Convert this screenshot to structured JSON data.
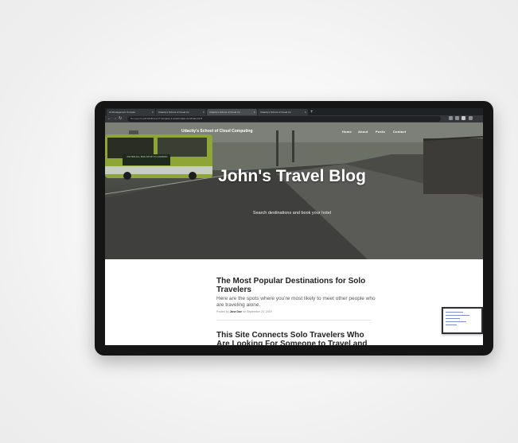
{
  "browser": {
    "tabs": [
      {
        "title": "AI Management Console",
        "active": false
      },
      {
        "title": "Udacity's School of Cloud Co",
        "active": false
      },
      {
        "title": "Udacity's School of Cloud Co",
        "active": true
      },
      {
        "title": "Udacity's School of Cloud Co",
        "active": false
      }
    ],
    "url_prefix": "Not secure",
    "url": "ec2-52-90-11-17.compute-1.amazonaws.com/index.html"
  },
  "site": {
    "brand": "Udacity's School of Cloud Computing",
    "nav": [
      "Home",
      "About",
      "Posts",
      "Contact"
    ],
    "hero_title": "John's Travel Blog",
    "hero_subtitle": "Search destinations and book your hotel"
  },
  "posts": [
    {
      "title": "The Most Popular Destinations for Solo Travelers",
      "subtitle": "Here are the spots where you're most likely to meet other people who are traveling alone.",
      "meta_prefix": "Posted by",
      "author": "Jane Doe",
      "date": "on September 24, 2019"
    },
    {
      "title": "This Site Connects Solo Travelers Who Are Looking For Someone to Travel and"
    }
  ],
  "bus_sign": "FW 500 ALL BUS STOP TO CARDIFF"
}
